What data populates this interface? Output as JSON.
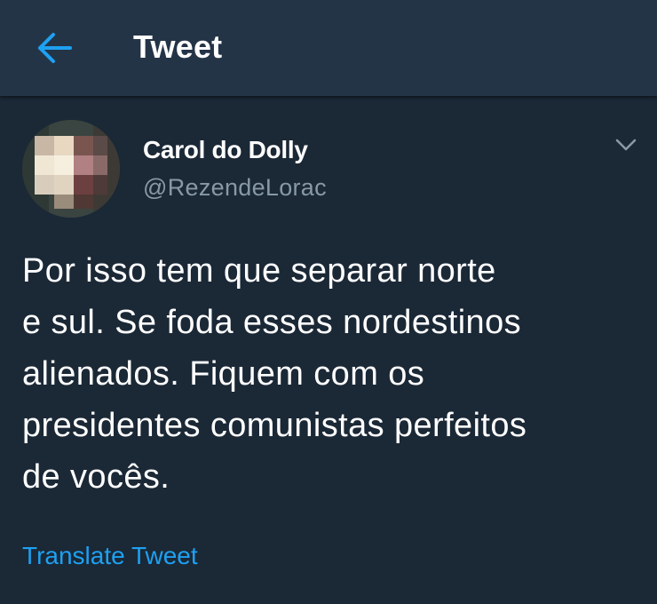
{
  "header": {
    "back_icon": "arrow-left-icon",
    "title": "Tweet"
  },
  "tweet": {
    "author_name": "Carol do Dolly",
    "author_handle": "@RezendeLorac",
    "avatar_icon": "pixelated-avatar",
    "menu_icon": "chevron-down-icon",
    "text": "Por isso tem que separar norte\ne sul. Se foda esses nordestinos\nalienados. Fiquem com os\npresidentes comunistas perfeitos\nde vocês.",
    "translate_label": "Translate Tweet"
  },
  "colors": {
    "background": "#1b2836",
    "app_bar": "#243447",
    "accent": "#1da1f2",
    "secondary_text": "#8899a6"
  }
}
